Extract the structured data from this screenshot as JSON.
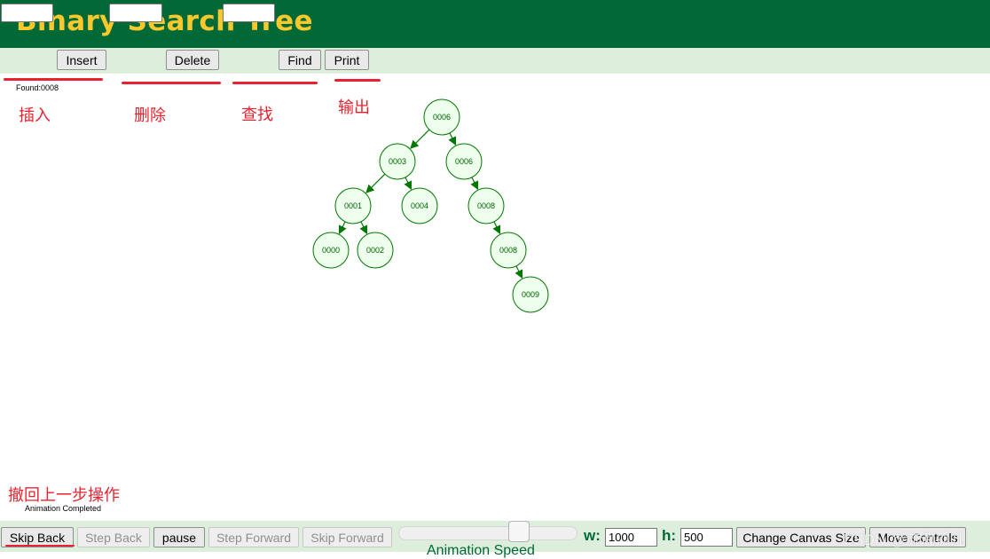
{
  "header": {
    "title": "Binary Search Tree"
  },
  "toolbar": {
    "insert_value": "",
    "insert_label": "Insert",
    "delete_value": "",
    "delete_label": "Delete",
    "find_value": "",
    "find_label": "Find",
    "print_label": "Print"
  },
  "status": {
    "top_message": "Found:0008",
    "bottom_message": "Animation Completed"
  },
  "annotations": {
    "insert": "插入",
    "delete": "删除",
    "find": "查找",
    "print": "输出",
    "skip_back": "撤回上一步操作",
    "color": "#e8232f"
  },
  "tree": {
    "node_fill": "#eeffee",
    "node_stroke": "#007700",
    "edge_color": "#007700",
    "nodes": [
      {
        "id": "n6a",
        "label": "0006"
      },
      {
        "id": "n3",
        "label": "0003"
      },
      {
        "id": "n6b",
        "label": "0006"
      },
      {
        "id": "n1",
        "label": "0001"
      },
      {
        "id": "n4",
        "label": "0004"
      },
      {
        "id": "n8a",
        "label": "0008"
      },
      {
        "id": "n0",
        "label": "0000"
      },
      {
        "id": "n2",
        "label": "0002"
      },
      {
        "id": "n8b",
        "label": "0008"
      },
      {
        "id": "n9",
        "label": "0009"
      }
    ],
    "edges": [
      [
        "n6a",
        "n3"
      ],
      [
        "n6a",
        "n6b"
      ],
      [
        "n3",
        "n1"
      ],
      [
        "n3",
        "n4"
      ],
      [
        "n6b",
        "n8a"
      ],
      [
        "n1",
        "n0"
      ],
      [
        "n1",
        "n2"
      ],
      [
        "n8a",
        "n8b"
      ],
      [
        "n8b",
        "n9"
      ]
    ]
  },
  "footer": {
    "skip_back": "Skip Back",
    "step_back": "Step Back",
    "pause": "pause",
    "step_forward": "Step Forward",
    "skip_forward": "Skip Forward",
    "speed_label": "Animation Speed",
    "speed_level": 0.74,
    "w_label": "w:",
    "w_value": "1000",
    "h_label": "h:",
    "h_value": "500",
    "change_canvas": "Change Canvas Size",
    "move_controls": "Move Controls"
  },
  "watermark": "CSDN @流浪孤儿",
  "theme": {
    "header_bg": "#006936",
    "title_color": "#f9c82d",
    "bar_bg": "#ddeedd"
  }
}
